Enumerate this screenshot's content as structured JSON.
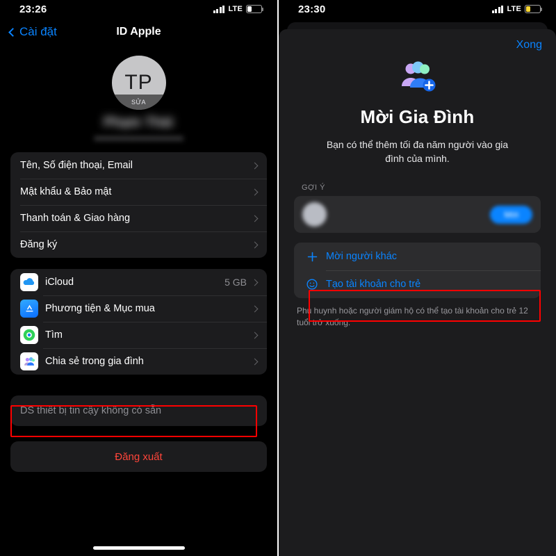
{
  "left": {
    "status": {
      "time": "23:26",
      "network": "LTE",
      "signal_icon": "cellular-bars-icon",
      "battery_icon": "battery-icon"
    },
    "nav": {
      "back_label": "Cài đặt",
      "back_icon": "chevron-left-icon",
      "title": "ID Apple"
    },
    "profile": {
      "initials": "TP",
      "edit_label": "SỬA",
      "name": "Phạm Thái",
      "email": "blurred-email"
    },
    "group1": [
      {
        "label": "Tên, Số điện thoại, Email"
      },
      {
        "label": "Mật khẩu & Bảo mật"
      },
      {
        "label": "Thanh toán & Giao hàng"
      },
      {
        "label": "Đăng ký"
      }
    ],
    "group2": [
      {
        "label": "iCloud",
        "value": "5 GB",
        "icon": "icloud-icon"
      },
      {
        "label": "Phương tiện & Mục mua",
        "value": "",
        "icon": "appstore-icon"
      },
      {
        "label": "Tìm",
        "value": "",
        "icon": "findmy-icon"
      },
      {
        "label": "Chia sẻ trong gia đình",
        "value": "",
        "icon": "family-sharing-icon"
      }
    ],
    "devices_note": "DS thiết bị tin cậy không có sẵn",
    "signout_label": "Đăng xuất"
  },
  "right": {
    "status": {
      "time": "23:30",
      "network": "LTE",
      "signal_icon": "cellular-bars-icon",
      "battery_icon": "battery-low-icon"
    },
    "done_label": "Xong",
    "hero": {
      "icon": "family-add-icon",
      "title": "Mời Gia Đình",
      "description": "Bạn có thể thêm tối đa năm người vào gia đình của mình."
    },
    "section_header": "GỢI Ý",
    "suggestion": {
      "name": "blurred-name",
      "subtitle": "blurred-subtitle",
      "button_label": "Mời"
    },
    "actions": [
      {
        "label": "Mời người khác",
        "icon": "plus-icon"
      },
      {
        "label": "Tạo tài khoản cho trẻ",
        "icon": "smiley-face-icon"
      }
    ],
    "footnote": "Phụ huynh hoặc người giám hộ có thể tạo tài khoản cho trẻ 12 tuổi trở xuống."
  },
  "colors": {
    "accent": "#0a84ff",
    "destructive": "#ff453a",
    "highlight": "#ff0000",
    "card": "#1c1c1e"
  }
}
